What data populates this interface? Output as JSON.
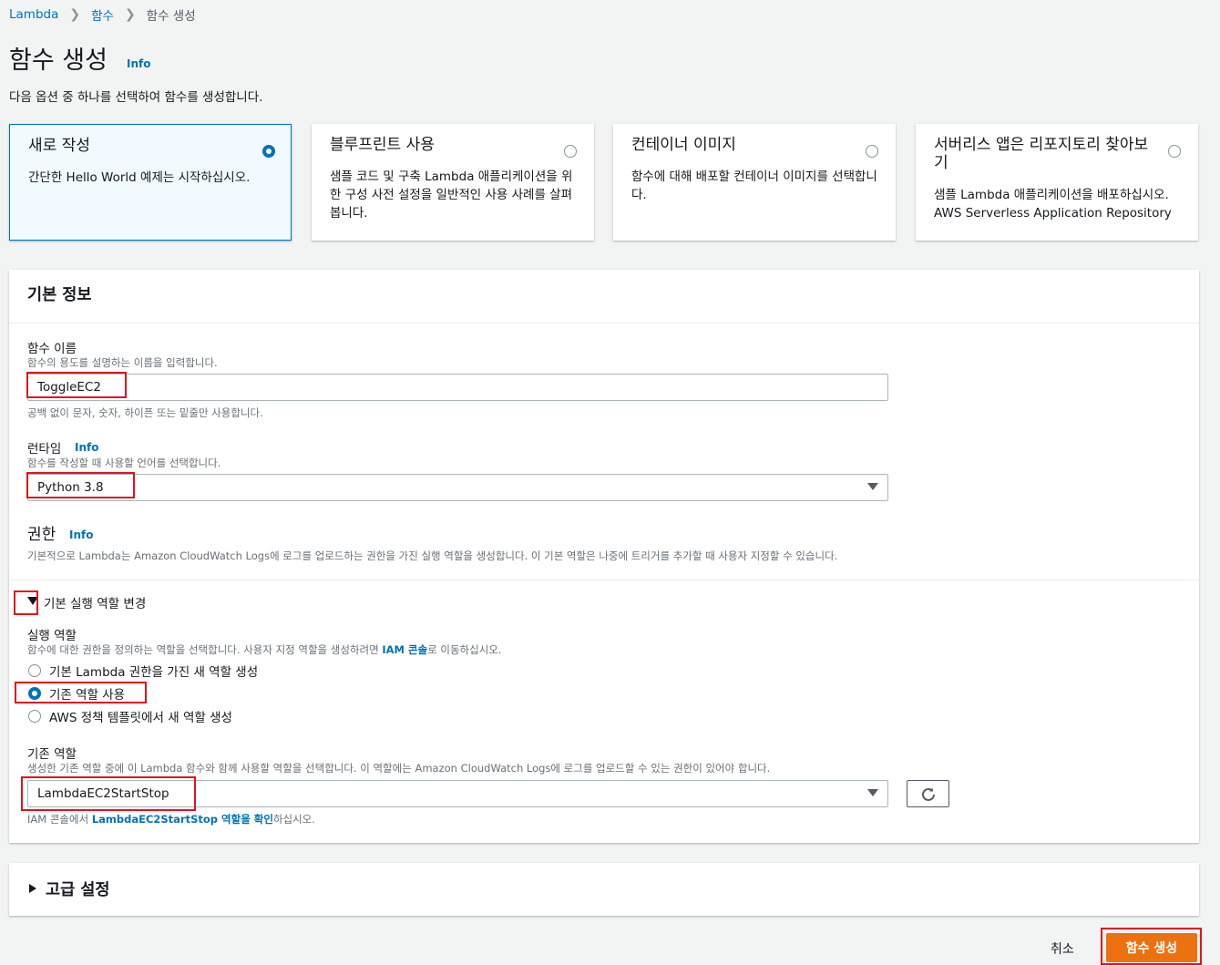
{
  "breadcrumb": {
    "items": [
      "Lambda",
      "함수",
      "함수 생성"
    ]
  },
  "page": {
    "title": "함수 생성",
    "info": "Info",
    "subtitle": "다음 옵션 중 하나를 선택하여 함수를 생성합니다."
  },
  "options": [
    {
      "title": "새로 작성",
      "desc": "간단한 Hello World 예제는 시작하십시오.",
      "selected": true
    },
    {
      "title": "블루프린트 사용",
      "desc": "샘플 코드 및 구축 Lambda 애플리케이션을 위한 구성 사전 설정을 일반적인 사용 사례를 살펴봅니다.",
      "selected": false
    },
    {
      "title": "컨테이너 이미지",
      "desc": "함수에 대해 배포할 컨테이너 이미지를 선택합니다.",
      "selected": false
    },
    {
      "title": "서버리스 앱은 리포지토리 찾아보기",
      "desc": "샘플 Lambda 애플리케이션을 배포하십시오. AWS Serverless Application Repository",
      "selected": false
    }
  ],
  "basic": {
    "heading": "기본 정보",
    "fn_name_label": "함수 이름",
    "fn_name_desc": "함수의 용도를 설명하는 이름을 입력합니다.",
    "fn_name_value": "ToggleEC2",
    "fn_name_hint": "공백 없이 문자, 숫자, 하이픈 또는 밑줄만 사용합니다.",
    "runtime_label": "런타임",
    "runtime_info": "Info",
    "runtime_desc": "함수를 작성할 때 사용할 언어를 선택합니다.",
    "runtime_value": "Python 3.8",
    "perm_label": "권한",
    "perm_info": "Info",
    "perm_desc": "기본적으로 Lambda는 Amazon CloudWatch Logs에 로그를 업로드하는 권한을 가진 실행 역할을 생성합니다. 이 기본 역할은 나중에 트리거를 추가할 때 사용자 지정할 수 있습니다.",
    "change_role": "기본 실행 역할 변경",
    "exec_role_label": "실행 역할",
    "exec_role_desc_a": "함수에 대한 권한을 정의하는 역할을 선택합니다. 사용자 지정 역할을 생성하려면 ",
    "exec_role_desc_link": "IAM 콘솔",
    "exec_role_desc_b": "로 이동하십시오.",
    "role_options": [
      {
        "label": "기본 Lambda 권한을 가진 새 역할 생성",
        "selected": false
      },
      {
        "label": "기존 역할 사용",
        "selected": true
      },
      {
        "label": "AWS 정책 템플릿에서 새 역할 생성",
        "selected": false
      }
    ],
    "existing_label": "기존 역할",
    "existing_desc": "생성한 기존 역할 중에 이 Lambda 함수와 함께 사용할 역할을 선택합니다. 이 역할에는 Amazon CloudWatch Logs에 로그를 업로드할 수 있는 권한이 있어야 합니다.",
    "existing_value": "LambdaEC2StartStop",
    "iam_hint_a": "IAM 콘솔에서 ",
    "iam_hint_link": "LambdaEC2StartStop 역할을 확인",
    "iam_hint_b": "하십시오."
  },
  "advanced": {
    "label": "고급 설정"
  },
  "footer": {
    "cancel": "취소",
    "create": "함수 생성"
  },
  "colors": {
    "accent": "#0073bb",
    "primary": "#ec7211",
    "highlight": "#e0141e"
  }
}
